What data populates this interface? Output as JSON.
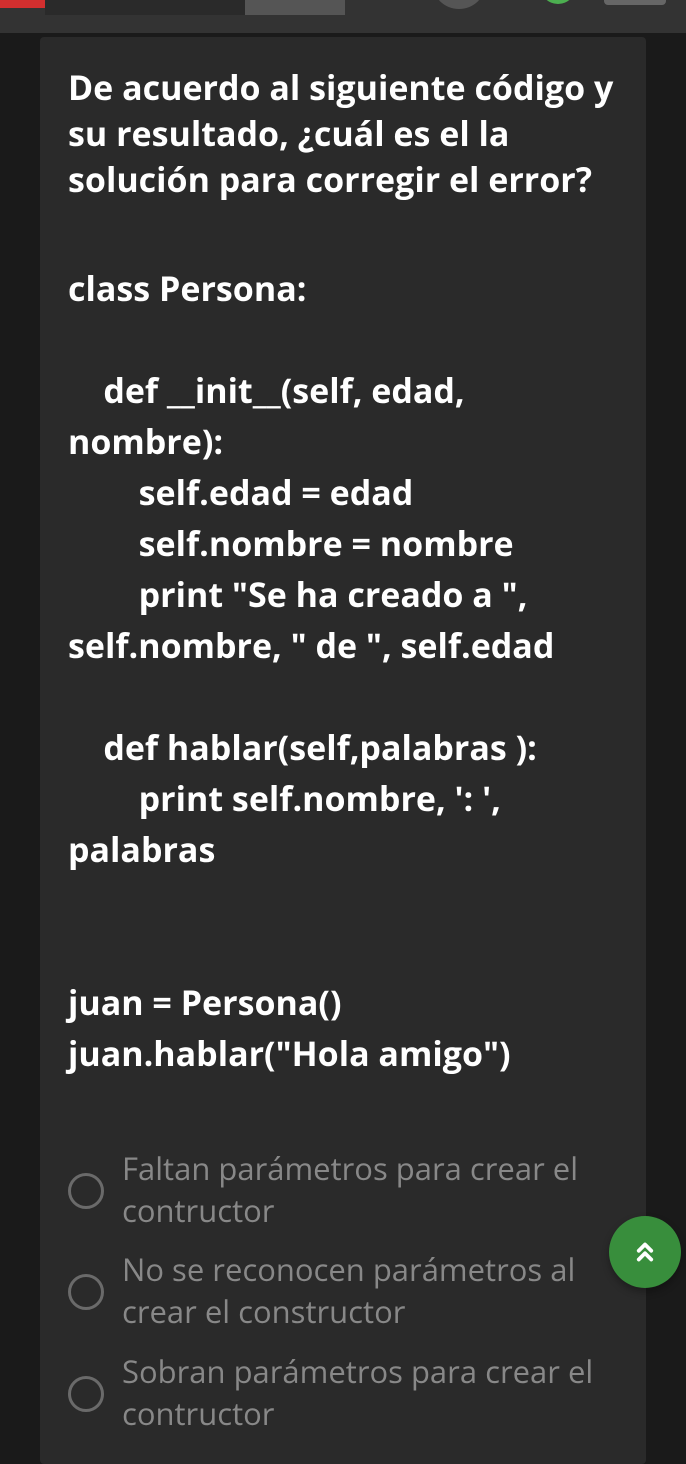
{
  "question": {
    "prompt": "De acuerdo al siguiente código y su resultado, ¿cuál es el la solución para corregir el error?",
    "code_lines": [
      "class Persona:",
      "",
      "    def __init__(self, edad, nombre):",
      "        self.edad = edad",
      "        self.nombre = nombre",
      "        print \"Se ha creado a \", self.nombre, \" de \", self.edad",
      "",
      "    def hablar(self,palabras ):",
      "        print self.nombre, ': ', palabras",
      "",
      "",
      "juan = Persona()",
      "juan.hablar(\"Hola amigo\")"
    ],
    "options": [
      {
        "id": "opt1",
        "label": "Faltan parámetros para crear el contructor"
      },
      {
        "id": "opt2",
        "label": "No se reconocen parámetros al crear el constructor"
      },
      {
        "id": "opt3",
        "label": "Sobran parámetros para crear el contructor"
      }
    ]
  },
  "fab": {
    "icon_label": "scroll-to-top"
  }
}
